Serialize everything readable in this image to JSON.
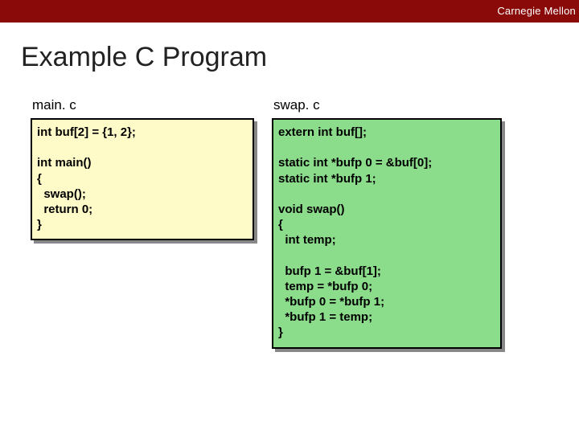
{
  "header": {
    "brand": "Carnegie Mellon"
  },
  "title": "Example C Program",
  "files": {
    "left": {
      "name": "main. c",
      "code": "int buf[2] = {1, 2};\n\nint main()\n{\n  swap();\n  return 0;\n}"
    },
    "right": {
      "name": "swap. c",
      "code": "extern int buf[];\n\nstatic int *bufp 0 = &buf[0];\nstatic int *bufp 1;\n\nvoid swap()\n{\n  int temp;\n\n  bufp 1 = &buf[1];\n  temp = *bufp 0;\n  *bufp 0 = *bufp 1;\n  *bufp 1 = temp;\n}"
    }
  }
}
